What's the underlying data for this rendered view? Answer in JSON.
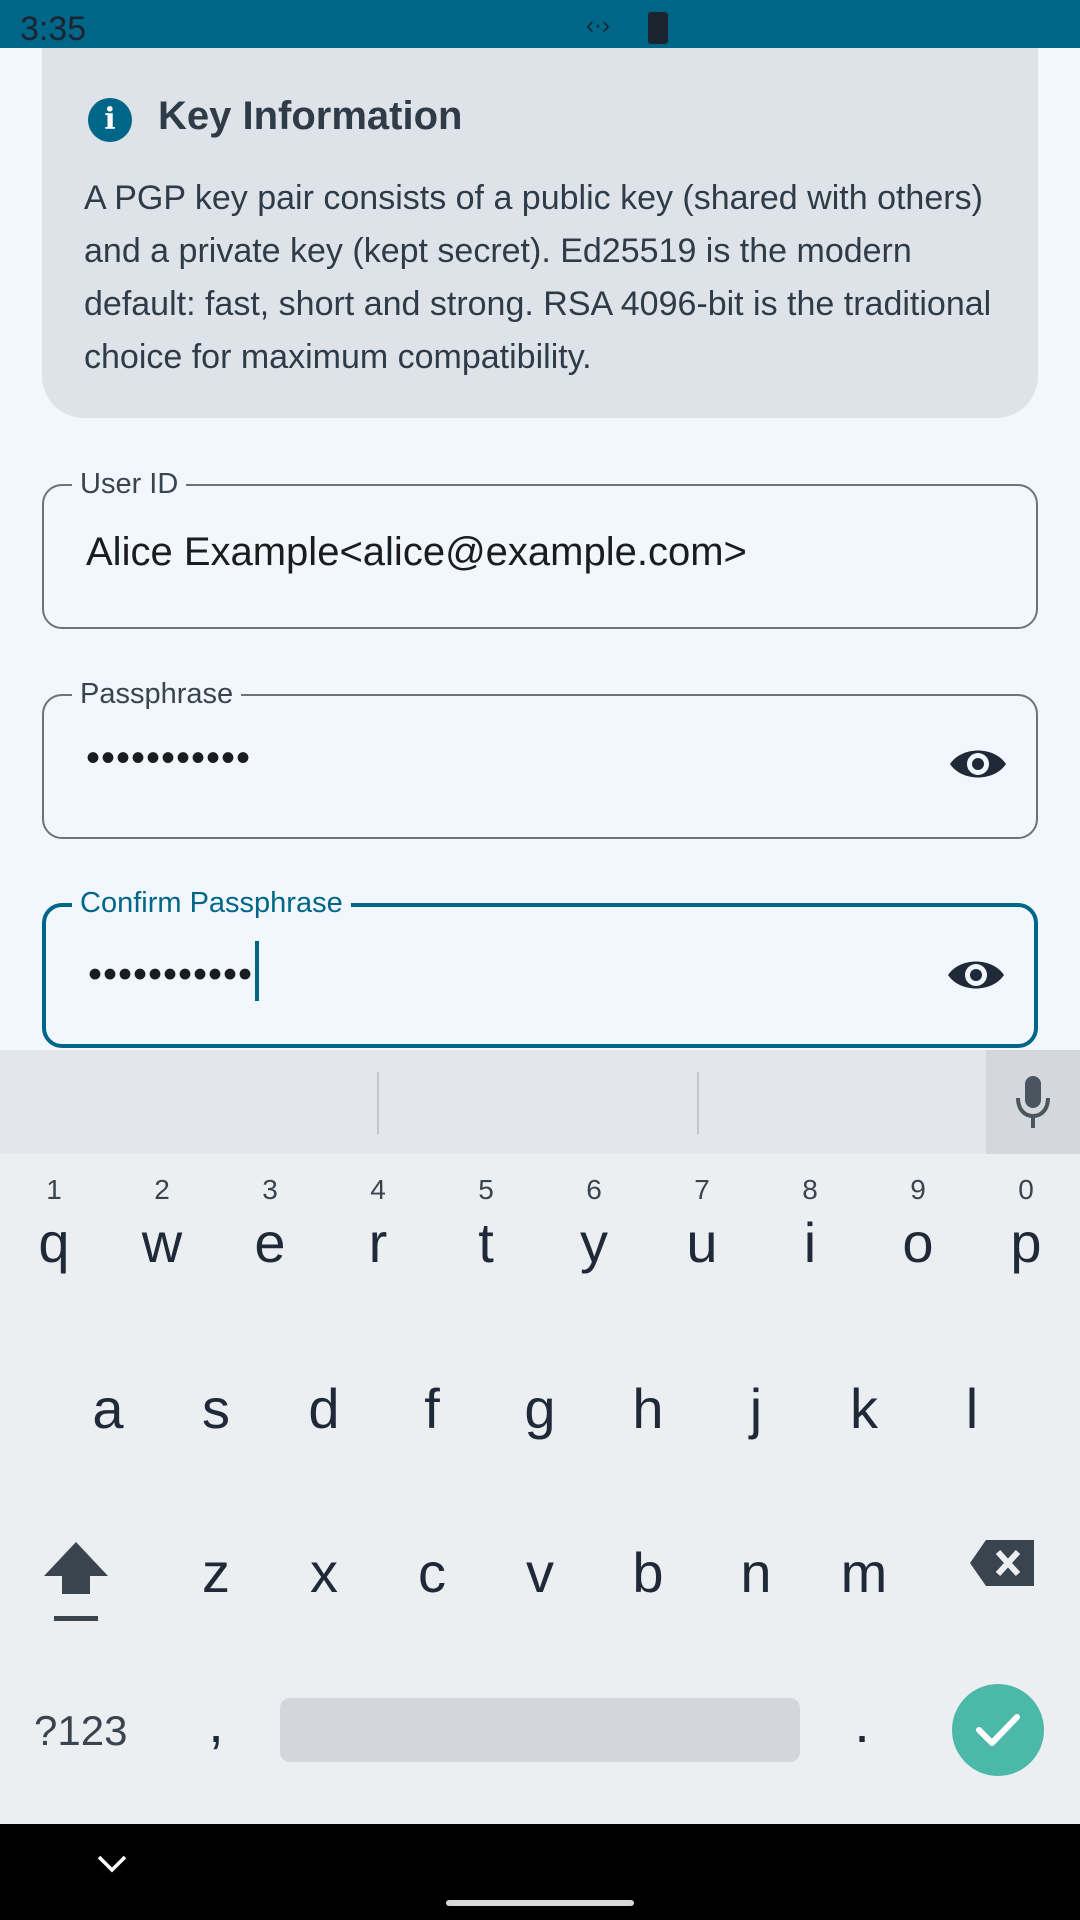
{
  "status_bar": {
    "time": "3:35",
    "center_glyph": "‹·›"
  },
  "info": {
    "icon": "info-icon",
    "title": "Key Information",
    "body": "A PGP key pair consists of a public key (shared with others) and a private key (kept secret). Ed25519 is the modern default: fast, short and strong. RSA 4096-bit is the traditional choice for maximum compatibility."
  },
  "fields": {
    "user_id": {
      "label": "User ID",
      "value": "Alice Example<alice@example.com>"
    },
    "passphrase": {
      "label": "Passphrase",
      "masked_value": "•••••••••••"
    },
    "confirm": {
      "label": "Confirm Passphrase",
      "masked_value": "•••••••••••"
    }
  },
  "keyboard": {
    "row1": [
      {
        "key": "q",
        "hint": "1"
      },
      {
        "key": "w",
        "hint": "2"
      },
      {
        "key": "e",
        "hint": "3"
      },
      {
        "key": "r",
        "hint": "4"
      },
      {
        "key": "t",
        "hint": "5"
      },
      {
        "key": "y",
        "hint": "6"
      },
      {
        "key": "u",
        "hint": "7"
      },
      {
        "key": "i",
        "hint": "8"
      },
      {
        "key": "o",
        "hint": "9"
      },
      {
        "key": "p",
        "hint": "0"
      }
    ],
    "row2": [
      "a",
      "s",
      "d",
      "f",
      "g",
      "h",
      "j",
      "k",
      "l"
    ],
    "row3": [
      "z",
      "x",
      "c",
      "v",
      "b",
      "n",
      "m"
    ],
    "symbols_label": "?123",
    "comma": ",",
    "period": "."
  },
  "colors": {
    "accent": "#006688",
    "enter": "#4bb8a8",
    "card": "#dee3ea",
    "background": "#f1f7fd"
  }
}
